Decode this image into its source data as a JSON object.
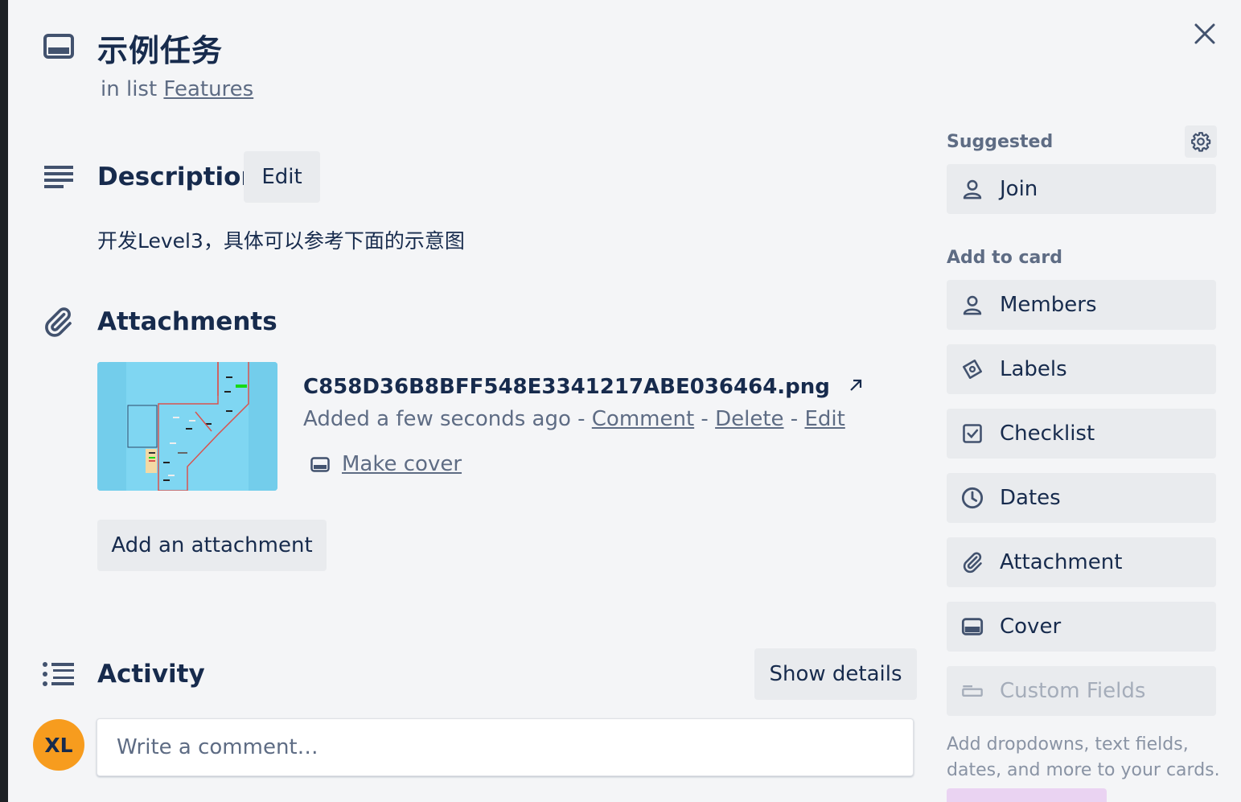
{
  "card": {
    "title": "示例任务",
    "in_list_prefix": "in list",
    "list_name": "Features"
  },
  "description": {
    "title": "Description",
    "edit_label": "Edit",
    "text": "开发Level3，具体可以参考下面的示意图"
  },
  "attachments": {
    "title": "Attachments",
    "file_name": "C858D36B8BFF548E3341217ABE036464.png",
    "added_text": "Added a few seconds ago",
    "separator": " - ",
    "comment_label": "Comment",
    "delete_label": "Delete",
    "edit_label": "Edit",
    "make_cover_label": "Make cover",
    "add_label": "Add an attachment"
  },
  "activity": {
    "title": "Activity",
    "show_details_label": "Show details",
    "avatar_initials": "XL",
    "comment_placeholder": "Write a comment…"
  },
  "sidebar": {
    "suggested_label": "Suggested",
    "join_label": "Join",
    "add_to_card_label": "Add to card",
    "items": [
      {
        "label": "Members",
        "icon": "person-icon"
      },
      {
        "label": "Labels",
        "icon": "tag-icon"
      },
      {
        "label": "Checklist",
        "icon": "checkbox-icon"
      },
      {
        "label": "Dates",
        "icon": "clock-icon"
      },
      {
        "label": "Attachment",
        "icon": "paperclip-icon"
      },
      {
        "label": "Cover",
        "icon": "cover-icon"
      },
      {
        "label": "Custom Fields",
        "icon": "custom-fields-icon",
        "disabled": true
      }
    ],
    "custom_fields_hint": "Add dropdowns, text fields, dates, and more to your cards."
  },
  "colors": {
    "modal_bg": "#f4f5f7",
    "button_bg": "#e9ebee",
    "text": "#172b4d",
    "muted": "#5e6c84",
    "avatar": "#f79c1e"
  }
}
